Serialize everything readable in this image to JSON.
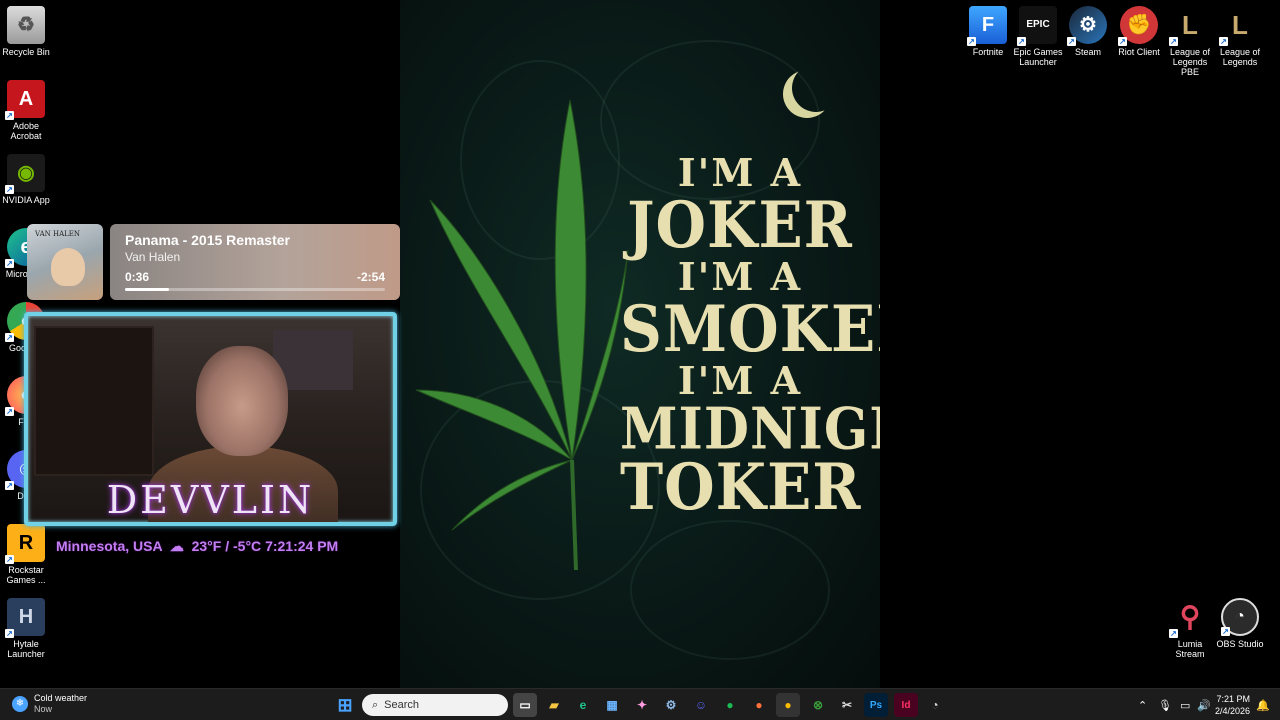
{
  "wallpaper": {
    "lines": [
      "I'M A",
      "JOKER",
      "I'M A",
      "SMOKER",
      "I'M A",
      "MIDNIGHT",
      "TOKER"
    ]
  },
  "desktop": {
    "left_icons": [
      {
        "label": "Recycle Bin",
        "icon": "recycle-bin-icon"
      },
      {
        "label": "Adobe Acrobat",
        "icon": "acrobat-icon"
      },
      {
        "label": "NVIDIA App",
        "icon": "nvidia-icon"
      },
      {
        "label": "Micro Edg",
        "icon": "edge-icon"
      },
      {
        "label": "Goo Chr",
        "icon": "chrome-icon"
      },
      {
        "label": "Fire",
        "icon": "firefox-icon"
      },
      {
        "label": "Disc",
        "icon": "discord-icon"
      },
      {
        "label": "Rockstar Games ...",
        "icon": "rockstar-icon"
      },
      {
        "label": "Hytale Launcher",
        "icon": "hytale-icon"
      }
    ],
    "right_icons": [
      {
        "label": "Fortnite",
        "icon": "fortnite-icon"
      },
      {
        "label": "Epic Games Launcher",
        "icon": "epic-games-icon"
      },
      {
        "label": "Steam",
        "icon": "steam-icon"
      },
      {
        "label": "Riot Client",
        "icon": "riot-client-icon"
      },
      {
        "label": "League of Legends PBE",
        "icon": "league-pbe-icon"
      },
      {
        "label": "League of Legends",
        "icon": "league-icon"
      },
      {
        "label": "Lumia Stream",
        "icon": "lumia-stream-icon"
      },
      {
        "label": "OBS Studio",
        "icon": "obs-studio-icon"
      }
    ]
  },
  "media": {
    "album_text": "VAN HALEN",
    "title": "Panama - 2015 Remaster",
    "artist": "Van Halen",
    "elapsed": "0:36",
    "remaining": "-2:54",
    "progress": 0.17
  },
  "stream": {
    "name": "DEVVLIN",
    "location": "Minnesota, USA",
    "weather": "23°F / -5°C",
    "time": "7:21:24 PM"
  },
  "taskbar": {
    "weather_title": "Cold weather",
    "weather_sub": "Now",
    "search_placeholder": "Search",
    "clock_time": "7:21 PM",
    "clock_date": "2/4/2026",
    "colors": {
      "background": "#1c1c1c",
      "accent": "#4aa3ff"
    }
  }
}
